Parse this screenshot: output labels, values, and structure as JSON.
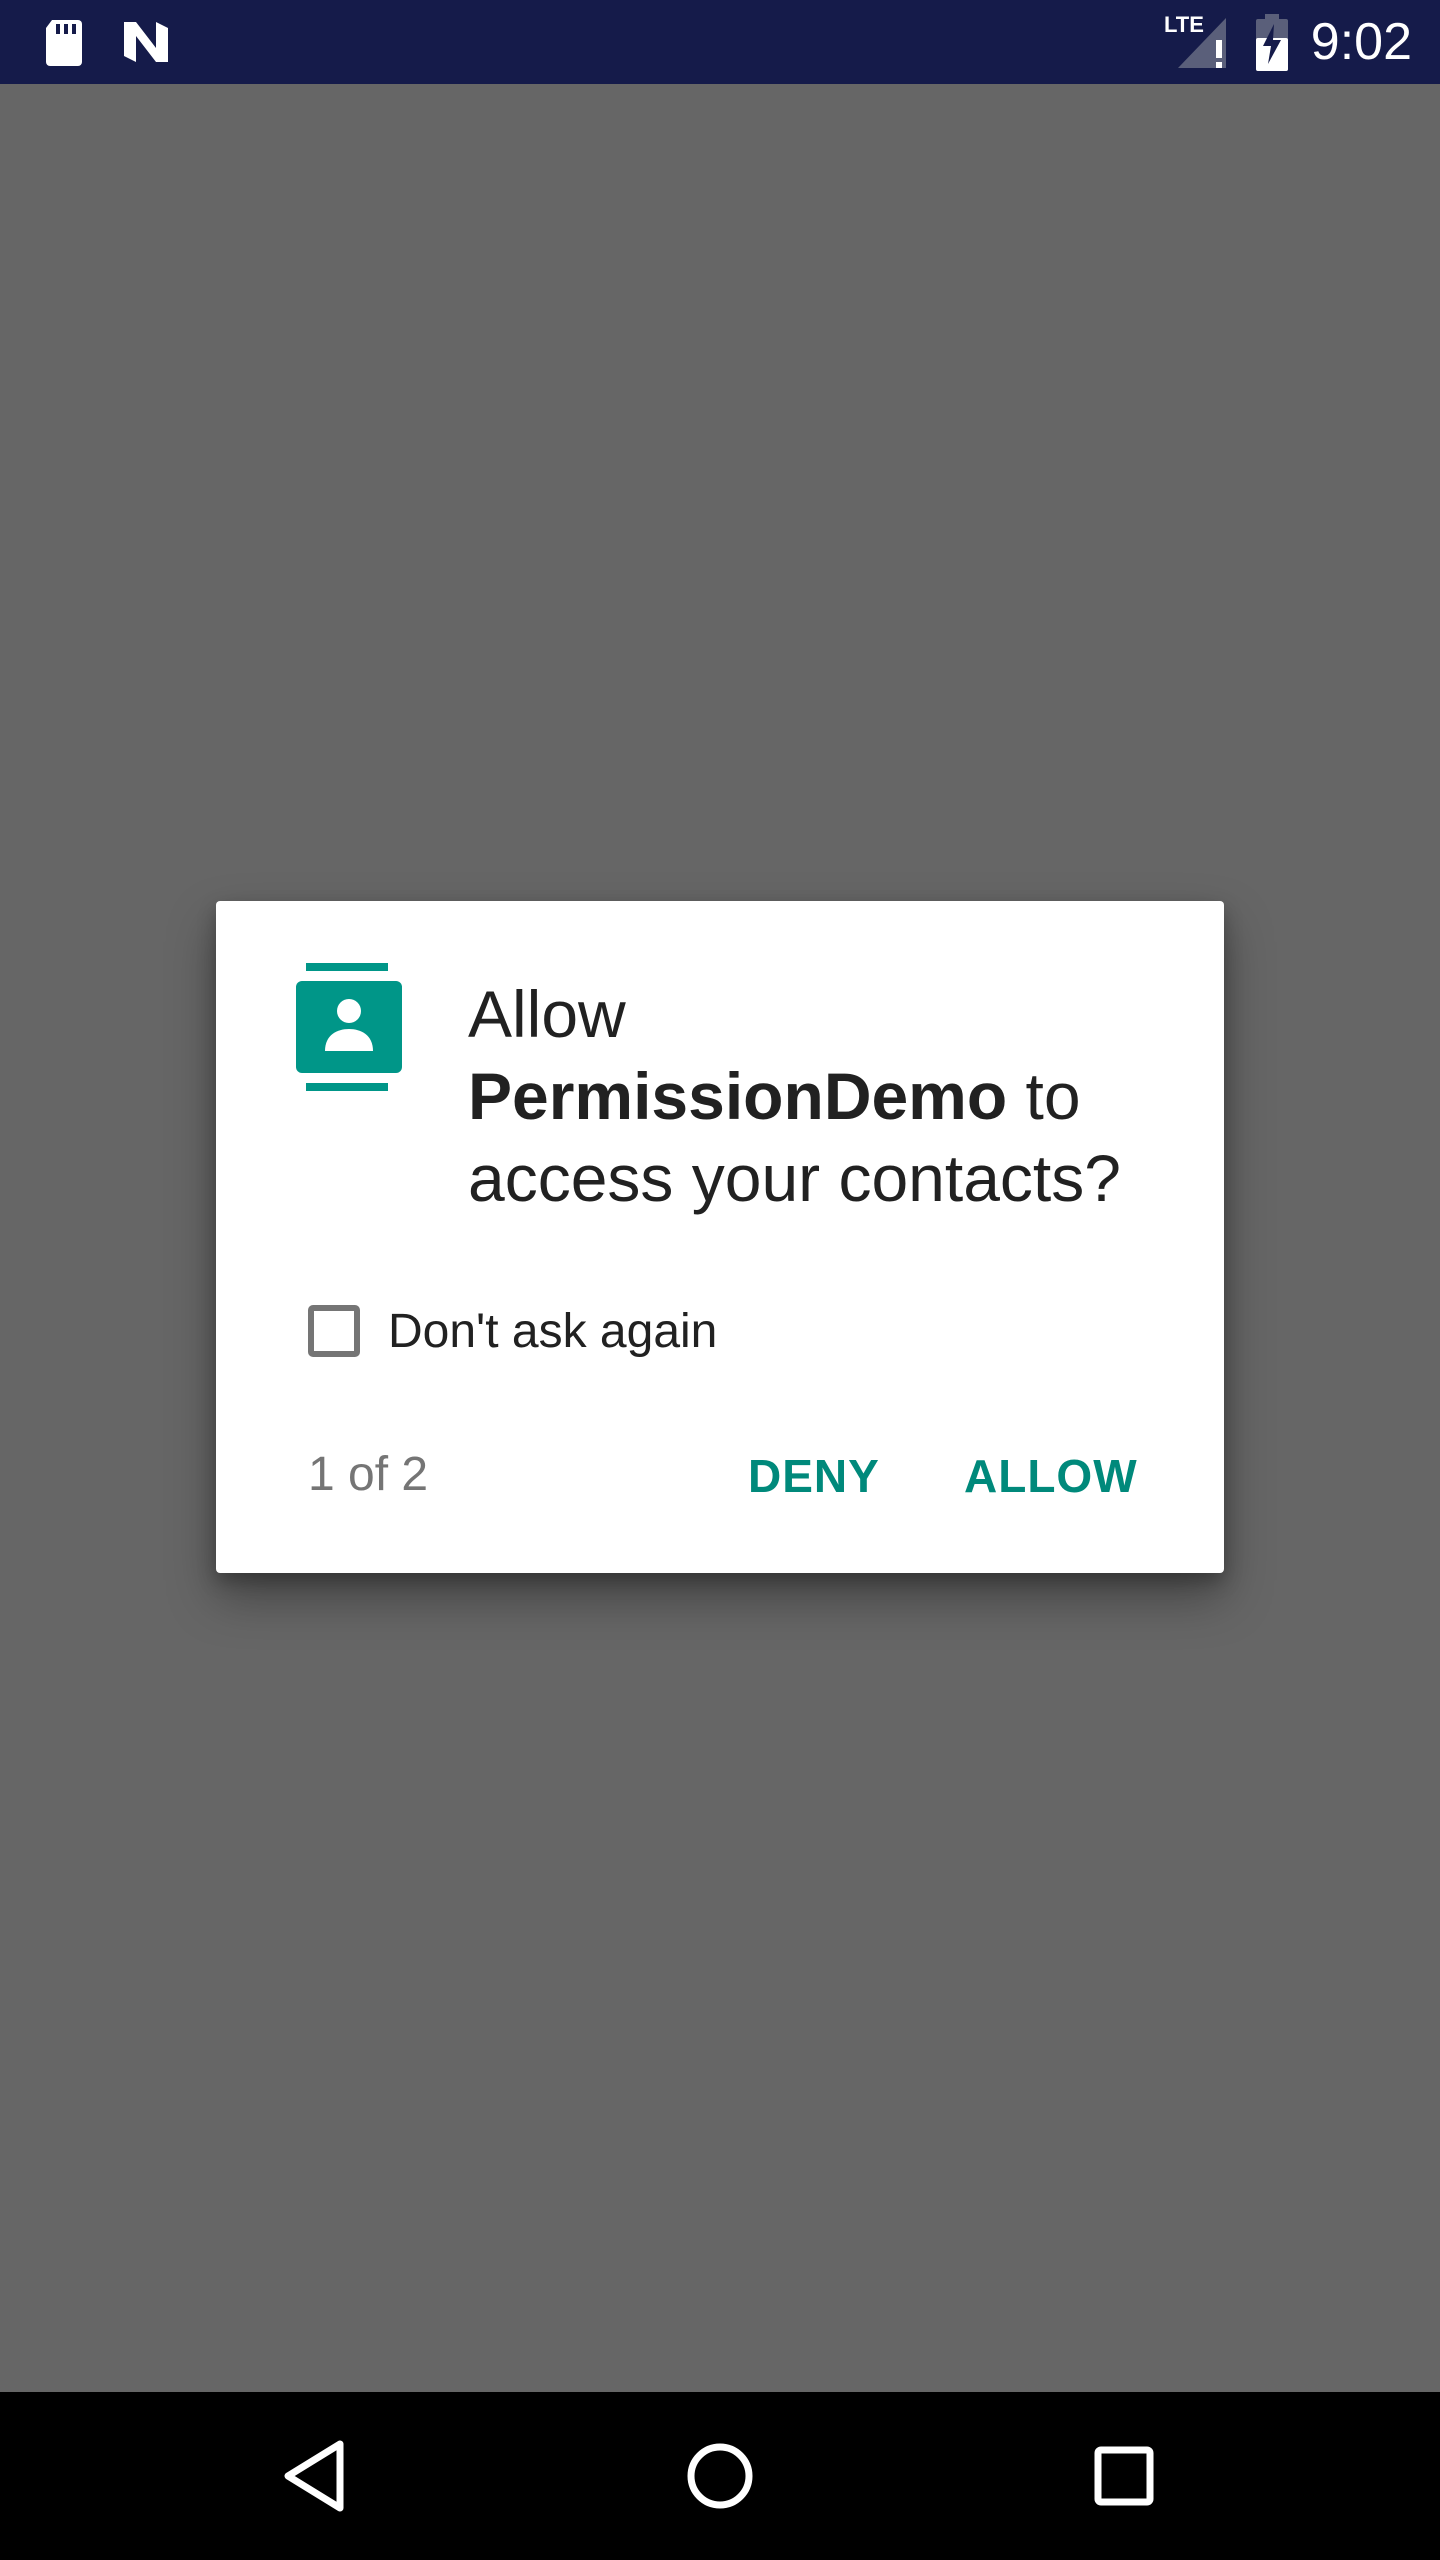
{
  "status_bar": {
    "time": "9:02",
    "left_icons": [
      "sd-card-icon",
      "android-n-icon"
    ],
    "right_icons": [
      "lte-signal-icon",
      "battery-charging-icon"
    ],
    "lte_label": "LTE"
  },
  "dialog": {
    "icon": "contacts-icon",
    "title_prefix": "Allow",
    "app_name": "PermissionDemo",
    "title_suffix_1": "to",
    "title_suffix_2": "access your contacts?",
    "checkbox_label": "Don't ask again",
    "checkbox_checked": false,
    "counter": "1 of 2",
    "deny_label": "DENY",
    "allow_label": "ALLOW",
    "accent_color": "#00897b"
  },
  "nav_bar": {
    "buttons": [
      "back-icon",
      "home-icon",
      "recents-icon"
    ]
  }
}
